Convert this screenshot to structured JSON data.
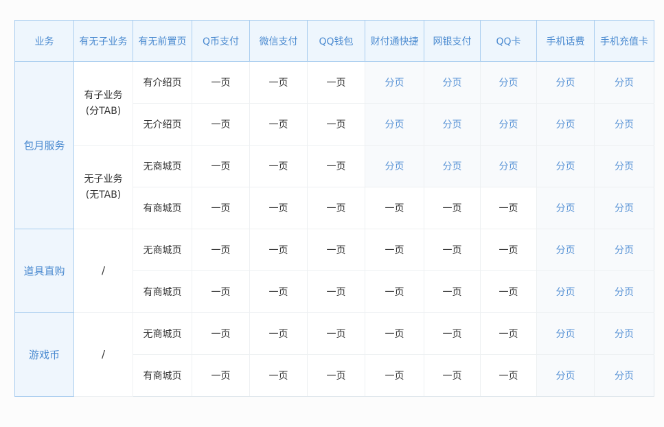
{
  "headers": [
    "业务",
    "有无子业务",
    "有无前置页",
    "Q币支付",
    "微信支付",
    "QQ钱包",
    "财付通快捷",
    "网银支付",
    "QQ卡",
    "手机话费",
    "手机充值卡"
  ],
  "groups": [
    {
      "name": "包月服务",
      "subs": [
        {
          "label_lines": [
            "有子业务",
            "(分TAB)"
          ],
          "rows": [
            {
              "page": "有介绍页",
              "cells": [
                "一页",
                "一页",
                "一页",
                "分页",
                "分页",
                "分页",
                "分页",
                "分页"
              ]
            },
            {
              "page": "无介绍页",
              "cells": [
                "一页",
                "一页",
                "一页",
                "分页",
                "分页",
                "分页",
                "分页",
                "分页"
              ]
            }
          ]
        },
        {
          "label_lines": [
            "无子业务",
            "(无TAB)"
          ],
          "rows": [
            {
              "page": "无商城页",
              "cells": [
                "一页",
                "一页",
                "一页",
                "分页",
                "分页",
                "分页",
                "分页",
                "分页"
              ]
            },
            {
              "page": "有商城页",
              "cells": [
                "一页",
                "一页",
                "一页",
                "一页",
                "一页",
                "一页",
                "分页",
                "分页"
              ]
            }
          ]
        }
      ]
    },
    {
      "name": "道具直购",
      "subs": [
        {
          "label_lines": [
            "/"
          ],
          "rows": [
            {
              "page": "无商城页",
              "cells": [
                "一页",
                "一页",
                "一页",
                "一页",
                "一页",
                "一页",
                "分页",
                "分页"
              ]
            },
            {
              "page": "有商城页",
              "cells": [
                "一页",
                "一页",
                "一页",
                "一页",
                "一页",
                "一页",
                "分页",
                "分页"
              ]
            }
          ]
        }
      ]
    },
    {
      "name": "游戏币",
      "subs": [
        {
          "label_lines": [
            "/"
          ],
          "rows": [
            {
              "page": "无商城页",
              "cells": [
                "一页",
                "一页",
                "一页",
                "一页",
                "一页",
                "一页",
                "分页",
                "分页"
              ]
            },
            {
              "page": "有商城页",
              "cells": [
                "一页",
                "一页",
                "一页",
                "一页",
                "一页",
                "一页",
                "分页",
                "分页"
              ]
            }
          ]
        }
      ]
    }
  ],
  "colors": {
    "accent": "#4a8ad0",
    "split_value": "#5a94d6",
    "header_bg": "#eef6fd"
  }
}
